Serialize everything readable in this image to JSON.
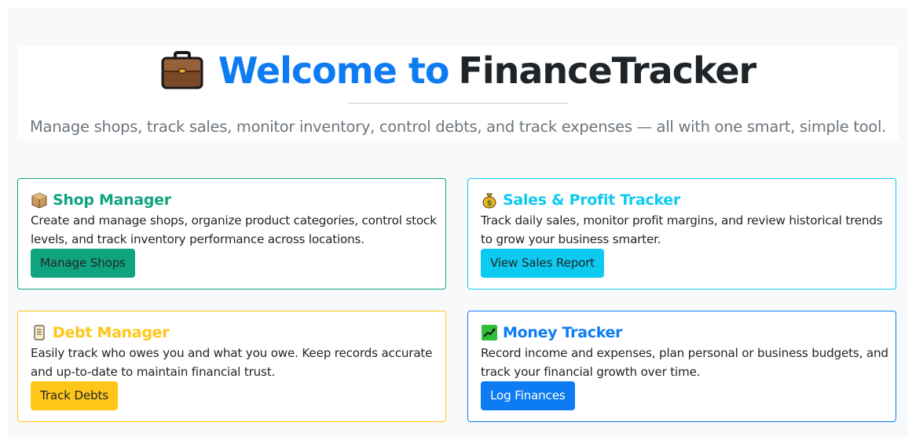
{
  "hero": {
    "title_accent": "Welcome to",
    "title_brand": "FinanceTracker",
    "tagline": "Manage shops, track sales, monitor inventory, control debts, and track expenses — all with one smart, simple tool.",
    "icon": "briefcase-icon"
  },
  "colors": {
    "primary": "#0d7cf2",
    "success": "#10a37f",
    "info": "#0dcaf0",
    "warning": "#ffc61a"
  },
  "cards": [
    {
      "icon": "package-icon",
      "title": "Shop Manager",
      "text": "Create and manage shops, organize product categories, control stock levels, and track inventory performance across locations.",
      "button": "Manage Shops"
    },
    {
      "icon": "money-bag-icon",
      "title": "Sales & Profit Tracker",
      "text": "Track daily sales, monitor profit margins, and review historical trends to grow your business smarter.",
      "button": "View Sales Report"
    },
    {
      "icon": "scroll-icon",
      "title": "Debt Manager",
      "text": "Easily track who owes you and what you owe. Keep records accurate and up-to-date to maintain financial trust.",
      "button": "Track Debts"
    },
    {
      "icon": "chart-increasing-icon",
      "title": "Money Tracker",
      "text": "Record income and expenses, plan personal or business budgets, and track your financial growth over time.",
      "button": "Log Finances"
    }
  ]
}
